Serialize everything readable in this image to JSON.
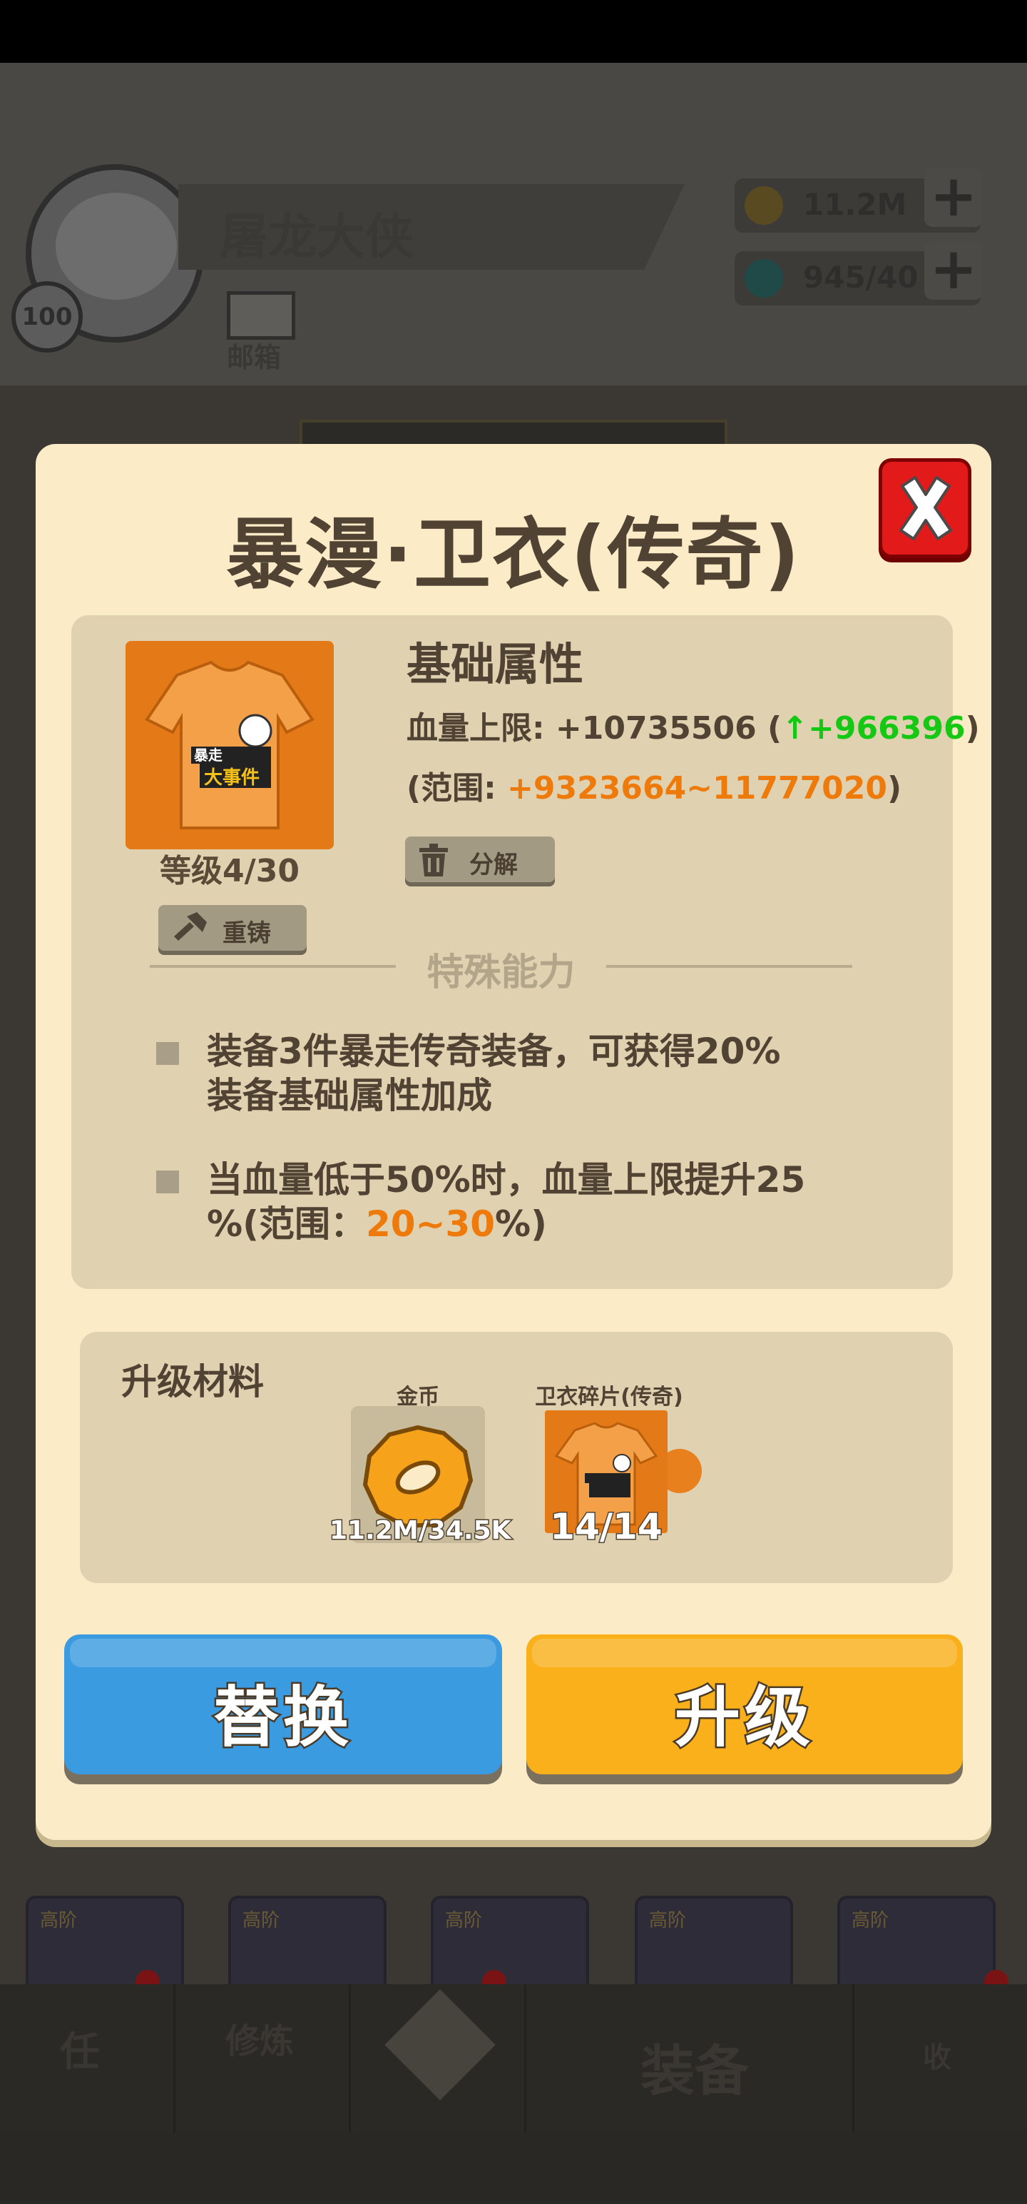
{
  "background": {
    "player": {
      "level": "100",
      "name": "屠龙大侠",
      "mail_label": "邮箱"
    },
    "resources": {
      "gold": "11.2M",
      "gems": "945/40",
      "plus_symbol": "+"
    },
    "slots": [
      {
        "tier": "高阶"
      },
      {
        "tier": "高阶"
      },
      {
        "tier": "高阶"
      },
      {
        "tier": "高阶"
      },
      {
        "tier": "高阶"
      }
    ],
    "nav": {
      "task": "任",
      "cultivate": "修炼",
      "equipment": "装备",
      "collect": "收"
    }
  },
  "modal": {
    "title": "暴漫·卫衣(传奇)",
    "item": {
      "level_text": "等级4/30",
      "shirt_text_top": "暴走",
      "shirt_text_bottom": "大事件",
      "recast_label": "重铸",
      "decompose_label": "分解"
    },
    "basic": {
      "title": "基础属性",
      "hp_label": "血量上限: ",
      "hp_value": "+10735506",
      "hp_paren_open": " (",
      "hp_arrow": "↑",
      "hp_increase": "+966396",
      "hp_paren_close": ")",
      "range_label": "(范围: ",
      "range_value": "+9323664~11777020",
      "range_close": ")"
    },
    "special": {
      "title": "特殊能力",
      "ability1_line1": "装备3件暴走传奇装备，可获得20%",
      "ability1_line2": "装备基础属性加成",
      "ability2_line1": "当血量低于50%时，血量上限提升25",
      "ability2_line2_a": "%(范围：",
      "ability2_line2_b": "20~30",
      "ability2_line2_c": "%)"
    },
    "materials": {
      "title": "升级材料",
      "coin_label": "金币",
      "coin_count": "11.2M/34.5K",
      "fragment_label": "卫衣碎片(传奇)",
      "fragment_count": "14/14"
    },
    "buttons": {
      "replace": "替换",
      "upgrade": "升级"
    }
  },
  "colors": {
    "modal_bg": "#fbebc6",
    "panel_bg": "#e0d2b0",
    "text_dark": "#514333",
    "green": "#14c814",
    "orange": "#ef7a0c",
    "replace_button": "#3b9be0",
    "upgrade_button": "#f9b01b",
    "close_button": "#e31a1a"
  },
  "icons": {
    "close": "close-x-icon",
    "recast": "hammer-icon",
    "decompose": "trash-icon",
    "coin": "gold-coin-icon",
    "fragment": "tshirt-fragment-icon"
  }
}
